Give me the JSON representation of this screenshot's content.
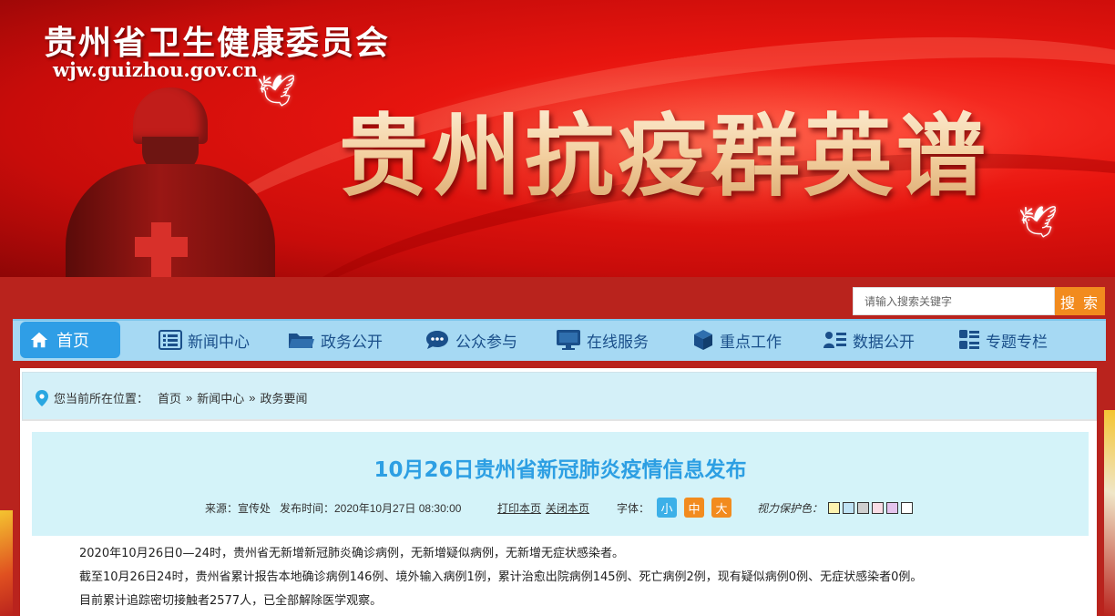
{
  "banner": {
    "org_name": "贵州省卫生健康委员会",
    "org_url": "wjw.guizhou.gov.cn",
    "headline": "贵州抗疫群英谱"
  },
  "search": {
    "placeholder": "请输入搜索关键字",
    "button_label": "搜 索"
  },
  "nav": {
    "home": "首页",
    "items": [
      {
        "label": "新闻中心",
        "icon": "news-list-icon"
      },
      {
        "label": "政务公开",
        "icon": "folder-icon"
      },
      {
        "label": "公众参与",
        "icon": "chat-bubble-icon"
      },
      {
        "label": "在线服务",
        "icon": "monitor-icon"
      },
      {
        "label": "重点工作",
        "icon": "cube-icon"
      },
      {
        "label": "数据公开",
        "icon": "user-list-icon"
      },
      {
        "label": "专题专栏",
        "icon": "grid-list-icon"
      }
    ]
  },
  "breadcrumb": {
    "prefix": "您当前所在位置：",
    "items": [
      "首页",
      "新闻中心",
      "政务要闻"
    ],
    "separator": "»"
  },
  "article": {
    "title": "10月26日贵州省新冠肺炎疫情信息发布",
    "source": "来源：宣传处",
    "publish_time": "发布时间：2020年10月27日 08:30:00",
    "print_label": "打印本页",
    "close_label": "关闭本页",
    "font_label": "字体：",
    "font_sizes": [
      "小",
      "中",
      "大"
    ],
    "font_size_colors": [
      "#3cb0e8",
      "#f28b1e",
      "#f28b1e"
    ],
    "eye_care_label": "视力保护色：",
    "eye_care_colors": [
      "#fdf3b0",
      "#bfe3f5",
      "#cfcfcf",
      "#f9dde6",
      "#e4c4ee",
      "#ffffff"
    ],
    "paragraphs": [
      "2020年10月26日0—24时，贵州省无新增新冠肺炎确诊病例，无新增疑似病例，无新增无症状感染者。",
      "截至10月26日24时，贵州省累计报告本地确诊病例146例、境外输入病例1例，累计治愈出院病例145例、死亡病例2例，现有疑似病例0例、无症状感染者0例。",
      "目前累计追踪密切接触者2577人，已全部解除医学观察。"
    ]
  },
  "colors": {
    "nav_bg": "#a6d9f3",
    "home_bg": "#2f9ee6",
    "title_blue": "#2d9fe3",
    "search_orange": "#f28b1e",
    "banner_red": "#e8150f"
  }
}
